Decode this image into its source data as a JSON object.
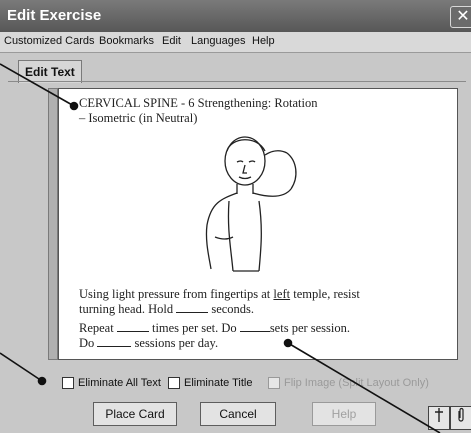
{
  "window": {
    "title": "Edit Exercise",
    "close_glyph": "✕"
  },
  "menu": [
    "Customized Cards",
    "Bookmarks",
    "Edit",
    "Languages",
    "Help"
  ],
  "tab": {
    "label": "Edit Text"
  },
  "card": {
    "title": "CERVICAL SPINE - 6  Strengthening: Rotation",
    "subtitle": "– Isometric (in Neutral)",
    "instruction_1a": "Using light pressure from fingertips at ",
    "instruction_1_side": "left",
    "instruction_1b": " temple, resist",
    "instruction_2a": "turning head. Hold ",
    "instruction_2b": " seconds.",
    "instruction_3a": "Repeat ",
    "instruction_3b": " times per set.  Do ",
    "instruction_3c": "sets per session.",
    "instruction_4a": "Do ",
    "instruction_4b": " sessions per day."
  },
  "options": {
    "eliminate_all_text": "Eliminate All Text",
    "eliminate_title": "Eliminate Title",
    "flip_image": "Flip Image (Split Layout Only)"
  },
  "buttons": {
    "place_card": "Place Card",
    "cancel": "Cancel",
    "help": "Help"
  },
  "icons": {
    "close": "close-icon",
    "pin": "pin-icon",
    "clip": "paperclip-icon"
  }
}
